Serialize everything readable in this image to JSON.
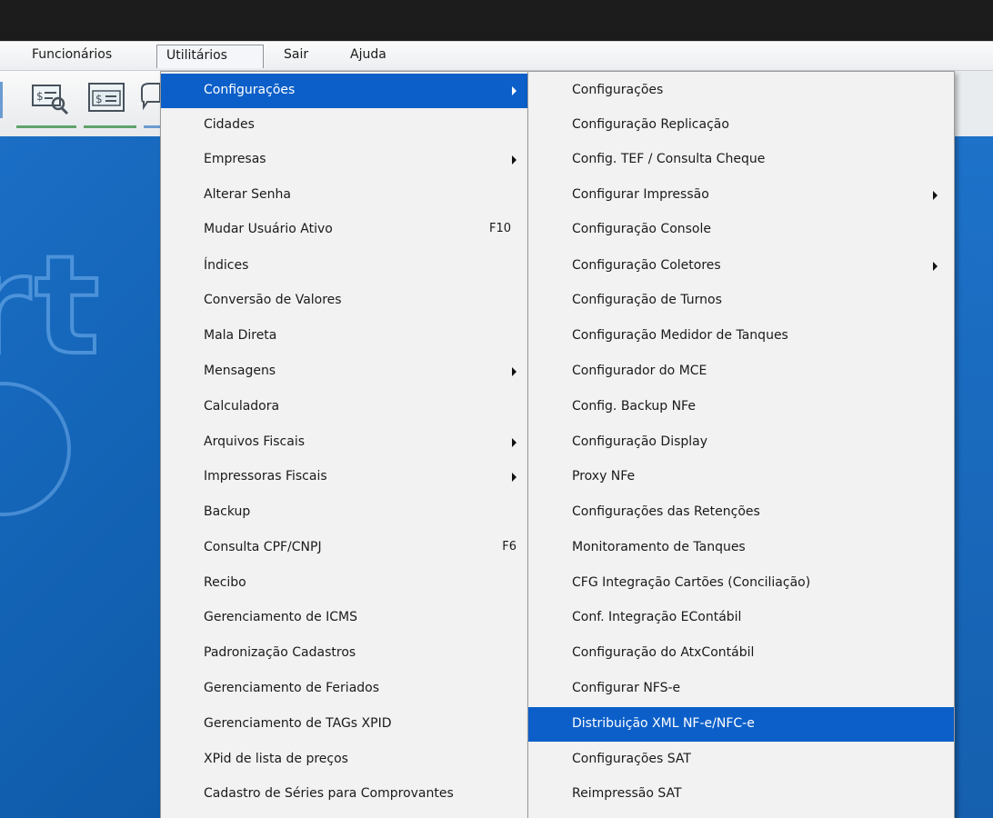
{
  "menubar": {
    "items": [
      "Funcionários",
      "Utilitários",
      "Sair",
      "Ajuda"
    ]
  },
  "utilitarios_menu": {
    "items": [
      {
        "label": "Configurações",
        "shortcut": "",
        "submenu": true,
        "highlighted": true
      },
      {
        "label": "Cidades",
        "shortcut": "",
        "submenu": false
      },
      {
        "label": "Empresas",
        "shortcut": "",
        "submenu": true
      },
      {
        "label": "Alterar Senha",
        "shortcut": "",
        "submenu": false
      },
      {
        "label": "Mudar Usuário Ativo",
        "shortcut": "F10",
        "submenu": false
      },
      {
        "label": "Índices",
        "shortcut": "",
        "submenu": false
      },
      {
        "label": "Conversão de Valores",
        "shortcut": "",
        "submenu": false
      },
      {
        "label": "Mala Direta",
        "shortcut": "",
        "submenu": false
      },
      {
        "label": "Mensagens",
        "shortcut": "",
        "submenu": true
      },
      {
        "label": "Calculadora",
        "shortcut": "",
        "submenu": false
      },
      {
        "label": "Arquivos Fiscais",
        "shortcut": "",
        "submenu": true
      },
      {
        "label": "Impressoras Fiscais",
        "shortcut": "",
        "submenu": true
      },
      {
        "label": "Backup",
        "shortcut": "",
        "submenu": false
      },
      {
        "label": "Consulta CPF/CNPJ",
        "shortcut": "F6",
        "submenu": false
      },
      {
        "label": "Recibo",
        "shortcut": "",
        "submenu": false
      },
      {
        "label": "Gerenciamento de ICMS",
        "shortcut": "",
        "submenu": false
      },
      {
        "label": "Padronização Cadastros",
        "shortcut": "",
        "submenu": false
      },
      {
        "label": "Gerenciamento de Feriados",
        "shortcut": "",
        "submenu": false
      },
      {
        "label": "Gerenciamento de TAGs XPID",
        "shortcut": "",
        "submenu": false
      },
      {
        "label": "XPid de lista de preços",
        "shortcut": "",
        "submenu": false
      },
      {
        "label": "Cadastro de Séries para Comprovantes",
        "shortcut": "",
        "submenu": false
      }
    ]
  },
  "configuracoes_submenu": {
    "items": [
      {
        "label": "Configurações",
        "submenu": false
      },
      {
        "label": "Configuração Replicação",
        "submenu": false
      },
      {
        "label": "Config. TEF / Consulta Cheque",
        "submenu": false
      },
      {
        "label": "Configurar Impressão",
        "submenu": true
      },
      {
        "label": "Configuração Console",
        "submenu": false
      },
      {
        "label": "Configuração Coletores",
        "submenu": true
      },
      {
        "label": "Configuração de Turnos",
        "submenu": false
      },
      {
        "label": "Configuração Medidor de Tanques",
        "submenu": false
      },
      {
        "label": "Configurador do MCE",
        "submenu": false
      },
      {
        "label": "Config. Backup NFe",
        "submenu": false
      },
      {
        "label": "Configuração Display",
        "submenu": false
      },
      {
        "label": "Proxy NFe",
        "submenu": false
      },
      {
        "label": "Configurações das Retenções",
        "submenu": false
      },
      {
        "label": "Monitoramento de Tanques",
        "submenu": false
      },
      {
        "label": "CFG Integração Cartões (Conciliação)",
        "submenu": false
      },
      {
        "label": "Conf. Integração EContábil",
        "submenu": false
      },
      {
        "label": "Configuração do AtxContábil",
        "submenu": false
      },
      {
        "label": "Configurar NFS-e",
        "submenu": false
      },
      {
        "label": "Distribuição XML NF-e/NFC-e",
        "submenu": false,
        "highlighted": true
      },
      {
        "label": "Configurações SAT",
        "submenu": false
      },
      {
        "label": "Reimpressão SAT",
        "submenu": false
      }
    ]
  },
  "colors": {
    "highlight": "#0c5fc9",
    "app_background": "#1465b8",
    "menu_background": "#f2f2f2"
  }
}
